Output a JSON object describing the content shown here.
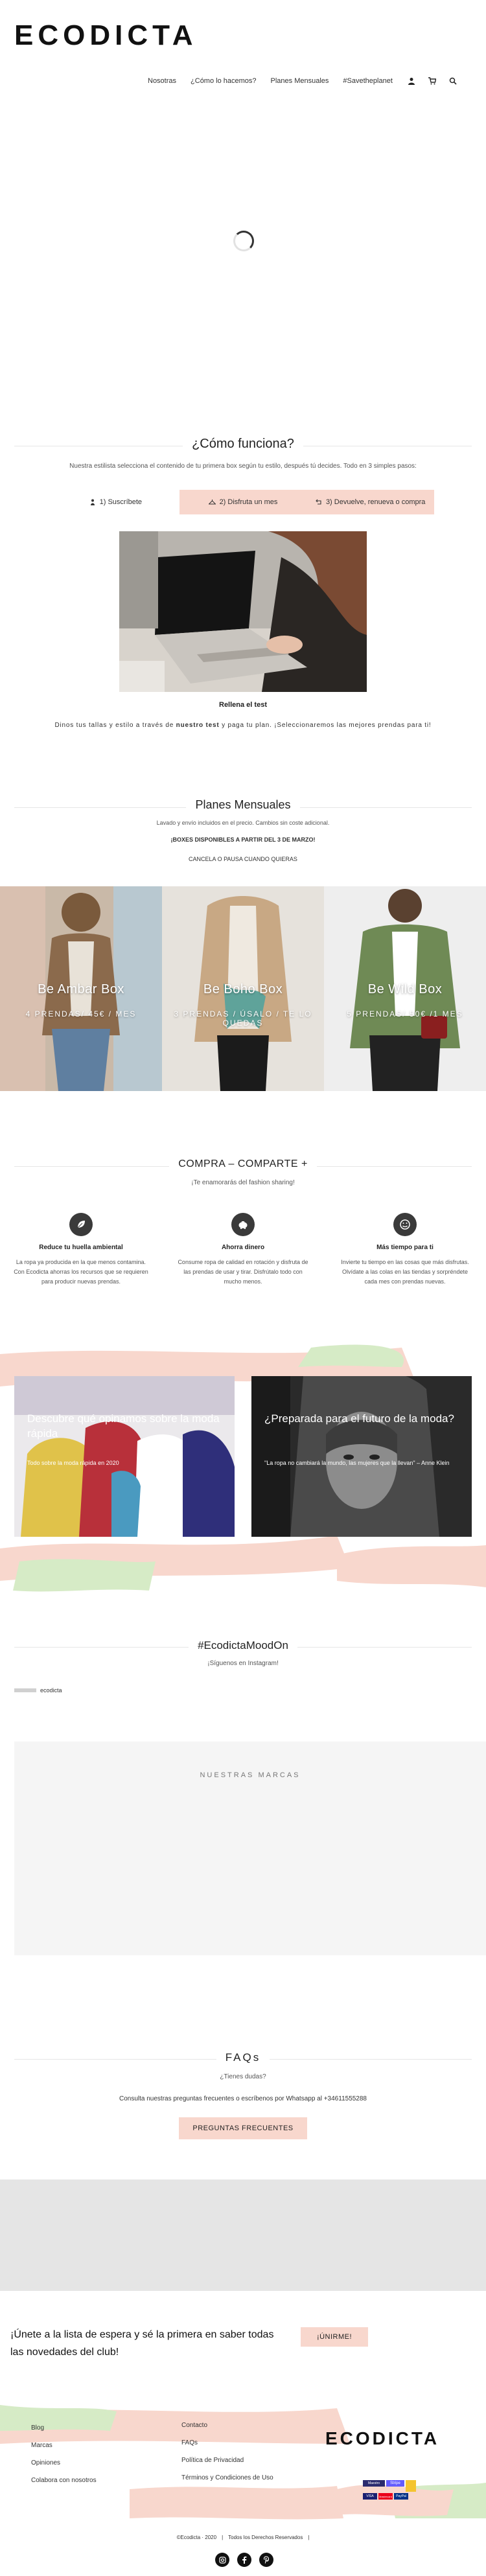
{
  "header": {
    "logo": "ECODICTA",
    "nav": [
      "Nosotras",
      "¿Cómo lo hacemos?",
      "Planes Mensuales",
      "#Savetheplanet"
    ],
    "icons": [
      "user-icon",
      "cart-icon",
      "search-icon"
    ]
  },
  "como": {
    "title": "¿Cómo funciona?",
    "intro": "Nuestra estilista selecciona el contenido de tu primera box según tu estilo, después tú decides. Todo en 3 simples pasos:",
    "steps": [
      "1) Suscríbete",
      "2) Disfruta un mes",
      "3) Devuelve, renueva o compra"
    ],
    "caption_title": "Rellena el test",
    "caption_text_a": "Dinos tus tallas y estilo a través de ",
    "caption_text_b": "nuestro test",
    "caption_text_c": " y paga tu plan. ¡Seleccionaremos las mejores prendas para ti!"
  },
  "planes": {
    "title": "Planes Mensuales",
    "line1": "Lavado y envío incluidos en el precio. Cambios sin coste adicional.",
    "line2": "¡BOXES DISPONIBLES A PARTIR DEL 3 DE MARZO!",
    "line3": "CANCELA O PAUSA CUANDO QUIERAS",
    "plans": [
      {
        "name": "Be Ambar Box",
        "price": "4 PRENDAS/ 45€ / MES"
      },
      {
        "name": "Be Boho Box",
        "price": "3 PRENDAS / ÚSALO / TE LO QUEDAS"
      },
      {
        "name": "Be Wild Box",
        "price": "5 PRENDAS/ 50€ /1 MES"
      }
    ]
  },
  "compra": {
    "title": "COMPRA – COMPARTE +",
    "subtitle": "¡Te enamorarás del fashion sharing!",
    "features": [
      {
        "icon": "leaf-icon",
        "title": "Reduce tu huella ambiental",
        "text": "La ropa ya producida en la que menos contamina. Con Ecodicta ahorras los recursos que se requieren para producir nuevas prendas."
      },
      {
        "icon": "piggy-bank-icon",
        "title": "Ahorra dinero",
        "text": "Consume ropa de calidad en rotación y disfruta de las prendas de usar y tirar. Disfrútalo todo con mucho menos."
      },
      {
        "icon": "smile-icon",
        "title": "Más tiempo para ti",
        "text": "Invierte tu tiempo en las cosas que más disfrutas. Olvídate a las colas en las tiendas y sorpréndete cada mes con prendas nuevas."
      }
    ],
    "cards": [
      {
        "title": "Descubre qué opinamos sobre la moda rápida",
        "sub": "Todo sobre la moda rápida en 2020"
      },
      {
        "title": "¿Preparada para el futuro de la moda?",
        "sub": "\"La ropa no cambiará la mundo, las mujeres que la llevan\" – Anne Klein"
      }
    ]
  },
  "insta": {
    "title": "#EcodictaMoodOn",
    "subtitle": "¡Síguenos en Instagram!",
    "handle": "ecodicta"
  },
  "marcas": {
    "title": "NUESTRAS MARCAS"
  },
  "faq": {
    "title": "FAQs",
    "q": "¿Tienes dudas?",
    "text": "Consulta nuestras preguntas frecuentes o escríbenos por Whatsapp al +34611555288",
    "button": "PREGUNTAS FRECUENTES"
  },
  "waitlist": {
    "text": "¡Únete a la lista de espera y sé la primera en saber todas las novedades del club!",
    "button": "¡ÚNIRME!"
  },
  "footer": {
    "col1": [
      "Blog",
      "Marcas",
      "Opiniones",
      "Colabora con nosotros"
    ],
    "col2": [
      "Contacto",
      "FAQs",
      "Política de Privacidad",
      "Términos y Condiciones de Uso"
    ],
    "logo": "ECODICTA",
    "payments": [
      "Maestro",
      "Stripe",
      "VISA",
      "Mastercard",
      "PayPal"
    ],
    "copyright": "©Ecodicta · 2020",
    "rights": "Todos los Derechos Reservados",
    "social": [
      "instagram-icon",
      "facebook-icon",
      "pinterest-icon"
    ]
  },
  "colors": {
    "accent_pink": "#f8d7cd",
    "accent_green": "#d6ebc6",
    "dark": "#111111",
    "panel_grey": "#f5f5f5"
  }
}
